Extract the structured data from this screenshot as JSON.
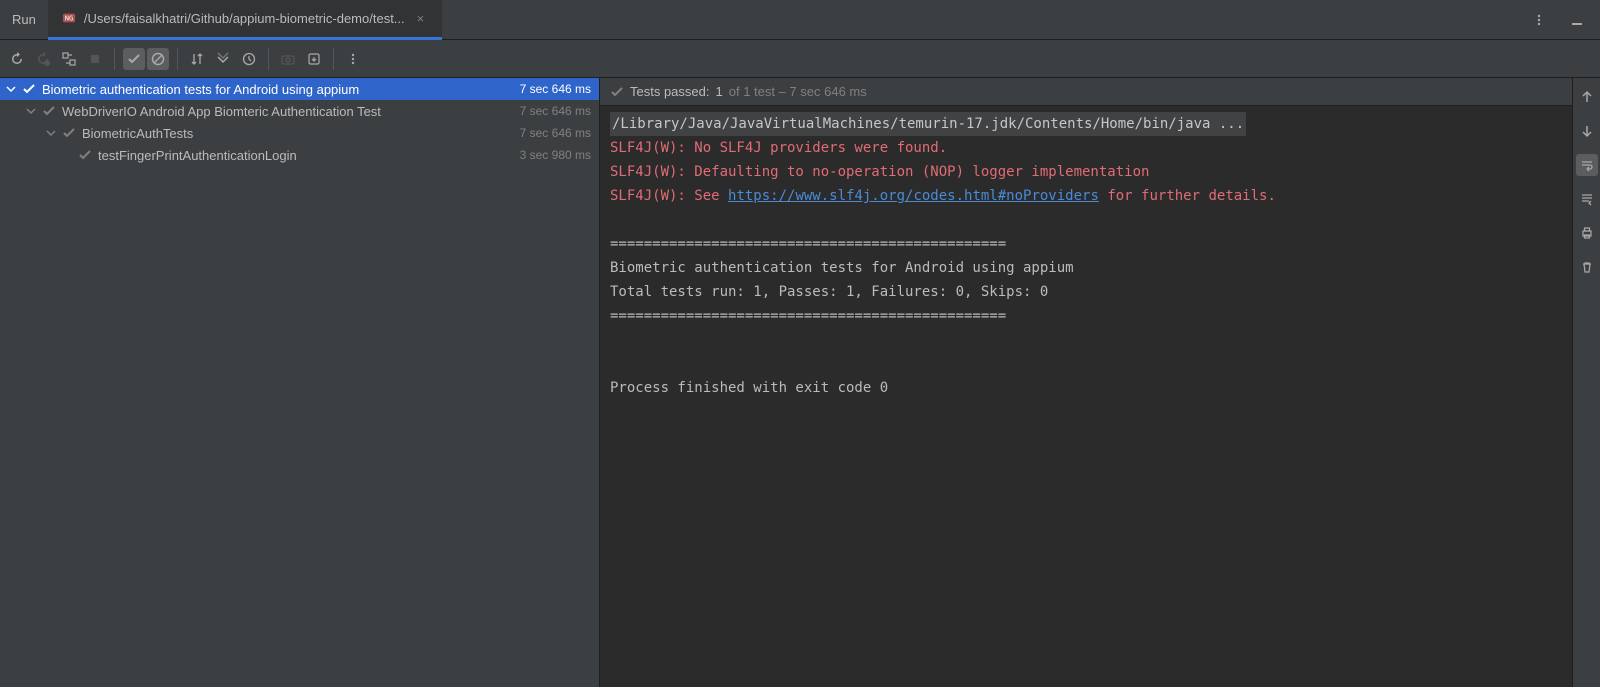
{
  "header": {
    "run_label": "Run",
    "tab_title": "/Users/faisalkhatri/Github/appium-biometric-demo/test..."
  },
  "tree": {
    "root": {
      "name": "Biometric authentication tests for Android using appium",
      "time": "7 sec 646 ms"
    },
    "level1": {
      "name": "WebDriverIO Android App Biomteric Authentication Test",
      "time": "7 sec 646 ms"
    },
    "level2": {
      "name": "BiometricAuthTests",
      "time": "7 sec 646 ms"
    },
    "level3": {
      "name": "testFingerPrintAuthenticationLogin",
      "time": "3 sec 980 ms"
    }
  },
  "status": {
    "passed_label": "Tests passed:",
    "passed_count": "1",
    "of_text": "of 1 test – 7 sec 646 ms"
  },
  "console": {
    "cmd": "/Library/Java/JavaVirtualMachines/temurin-17.jdk/Contents/Home/bin/java ...",
    "warn1": "SLF4J(W): No SLF4J providers were found.",
    "warn2": "SLF4J(W): Defaulting to no-operation (NOP) logger implementation",
    "warn3_pre": "SLF4J(W): See ",
    "warn3_link": "https://www.slf4j.org/codes.html#noProviders",
    "warn3_post": " for further details.",
    "sep": "===============================================",
    "suite": "Biometric authentication tests for Android using appium",
    "summary": "Total tests run: 1, Passes: 1, Failures: 0, Skips: 0",
    "exit": "Process finished with exit code 0"
  }
}
